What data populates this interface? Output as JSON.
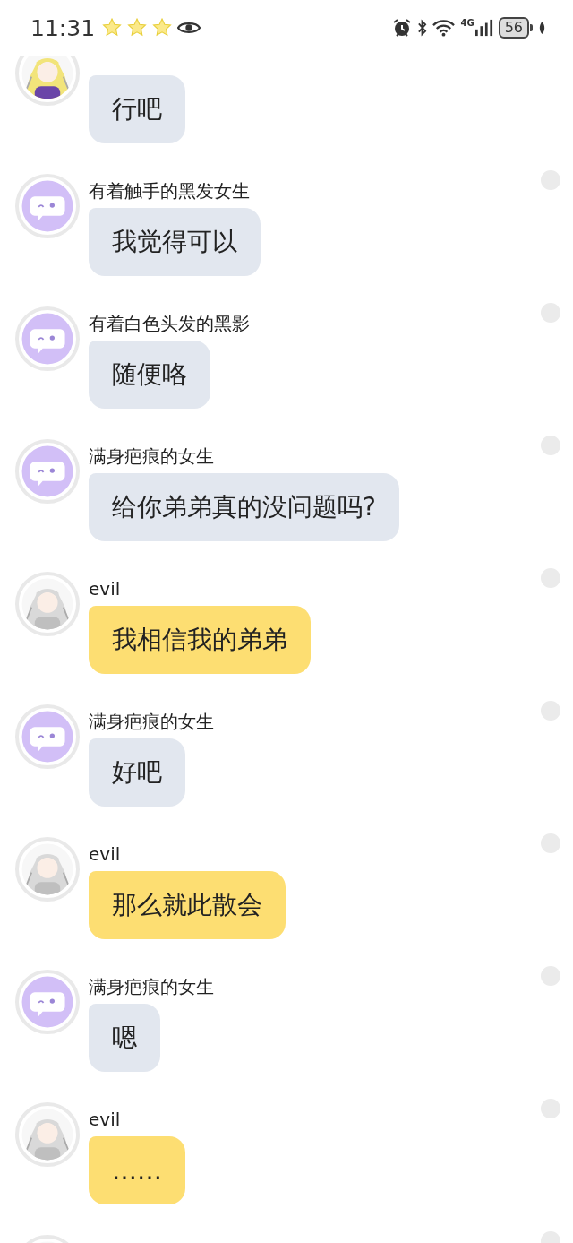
{
  "status_bar": {
    "time": "11:31",
    "network": "4G",
    "battery": "56"
  },
  "messages": [
    {
      "kind": "other",
      "text": "行吧"
    },
    {
      "sender": "有着触手的黑发女生",
      "avatar": {
        "kind": "default"
      },
      "kind": "other",
      "text": "我觉得可以",
      "checked": false
    },
    {
      "sender": "有着白色头发的黑影",
      "avatar": {
        "kind": "default"
      },
      "kind": "other",
      "text": "随便咯",
      "checked": false
    },
    {
      "sender": "满身疤痕的女生",
      "avatar": {
        "kind": "default"
      },
      "kind": "other",
      "text": "给你弟弟真的没问题吗?",
      "checked": false
    },
    {
      "sender": "evil",
      "kind": "own",
      "text": "我相信我的弟弟",
      "checked": false
    },
    {
      "sender": "满身疤痕的女生",
      "avatar": {
        "kind": "default"
      },
      "kind": "other",
      "text": "好吧",
      "checked": false
    },
    {
      "sender": "evil",
      "kind": "own",
      "text": "那么就此散会",
      "checked": false
    },
    {
      "sender": "满身疤痕的女生",
      "avatar": {
        "kind": "default"
      },
      "kind": "other",
      "text": "嗯",
      "checked": false
    },
    {
      "sender": "evil",
      "kind": "own",
      "text": "……",
      "checked": false
    },
    {
      "checked": false
    }
  ]
}
